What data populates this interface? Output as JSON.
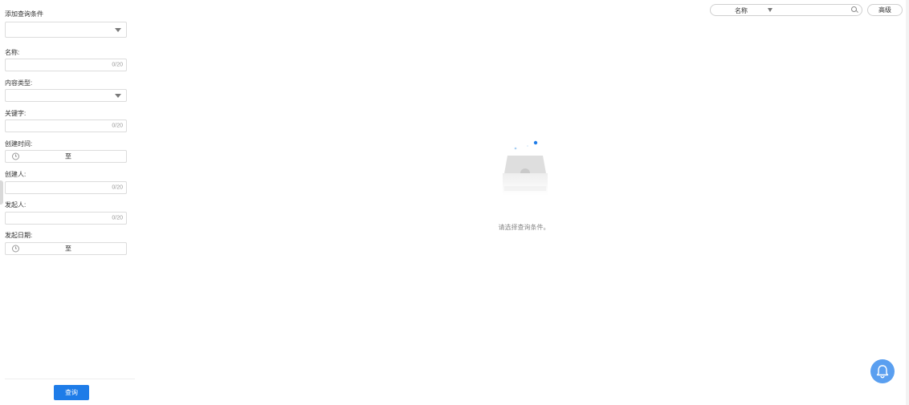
{
  "filters": {
    "add_condition_label": "添加查询条件",
    "name_label": "名称:",
    "name_counter": "0/20",
    "content_type_label": "内容类型:",
    "keyword_label": "关键字:",
    "keyword_counter": "0/20",
    "created_time_label": "创建时间:",
    "created_time_sep": "至",
    "creator_label": "创建人:",
    "creator_counter": "0/20",
    "initiator_label": "发起人:",
    "initiator_counter": "0/20",
    "initiated_date_label": "发起日期:",
    "initiated_date_sep": "至",
    "query_button": "查询"
  },
  "search": {
    "field_label": "名称",
    "advanced_button": "高级"
  },
  "empty_state": {
    "message": "请选择查询条件。"
  },
  "icons": {
    "search": "search-icon",
    "bell": "bell-icon",
    "clock": "clock-icon",
    "dropdown": "chevron-down-icon"
  },
  "colors": {
    "accent": "#1e7ce8",
    "bell": "#5a9ff0"
  }
}
